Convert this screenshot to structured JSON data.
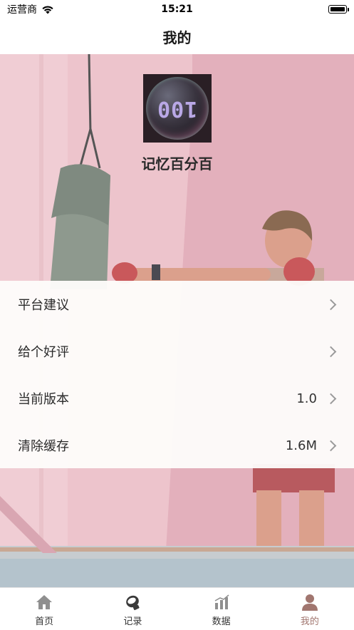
{
  "status_bar": {
    "carrier": "运营商",
    "time": "15:21"
  },
  "nav": {
    "title": "我的"
  },
  "profile": {
    "avatar_text": "100",
    "app_name": "记忆百分百"
  },
  "menu": [
    {
      "label": "平台建议",
      "value": ""
    },
    {
      "label": "给个好评",
      "value": ""
    },
    {
      "label": "当前版本",
      "value": "1.0"
    },
    {
      "label": "清除缓存",
      "value": "1.6M"
    }
  ],
  "tabs": [
    {
      "label": "首页",
      "icon": "home-icon",
      "active": false
    },
    {
      "label": "记录",
      "icon": "boxing-glove-icon",
      "active": false
    },
    {
      "label": "数据",
      "icon": "bar-chart-icon",
      "active": false
    },
    {
      "label": "我的",
      "icon": "person-icon",
      "active": true
    }
  ],
  "colors": {
    "accent": "#a1766f",
    "tab_inactive": "#8f8f8f",
    "hero_bg": "#e6b9c3"
  }
}
